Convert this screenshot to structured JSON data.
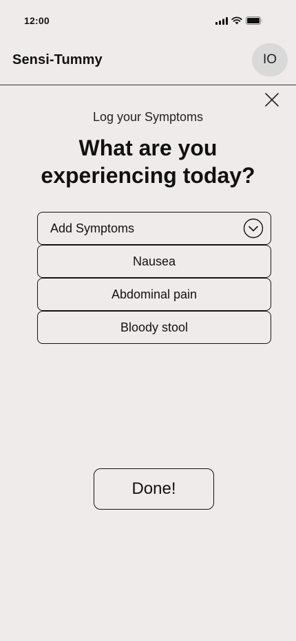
{
  "status_bar": {
    "time": "12:00",
    "icons": [
      "signal-icon",
      "wifi-icon",
      "battery-icon"
    ]
  },
  "header": {
    "app_title": "Sensi-Tummy",
    "avatar_initials": "IO"
  },
  "modal": {
    "close_icon": "close-icon",
    "subtitle": "Log your Symptoms",
    "heading": "What are you experiencing today?",
    "dropdown": {
      "label": "Add Symptoms",
      "icon": "chevron-down-icon"
    },
    "symptoms": [
      "Nausea",
      "Abdominal pain",
      "Bloody stool"
    ],
    "done_label": "Done!"
  }
}
